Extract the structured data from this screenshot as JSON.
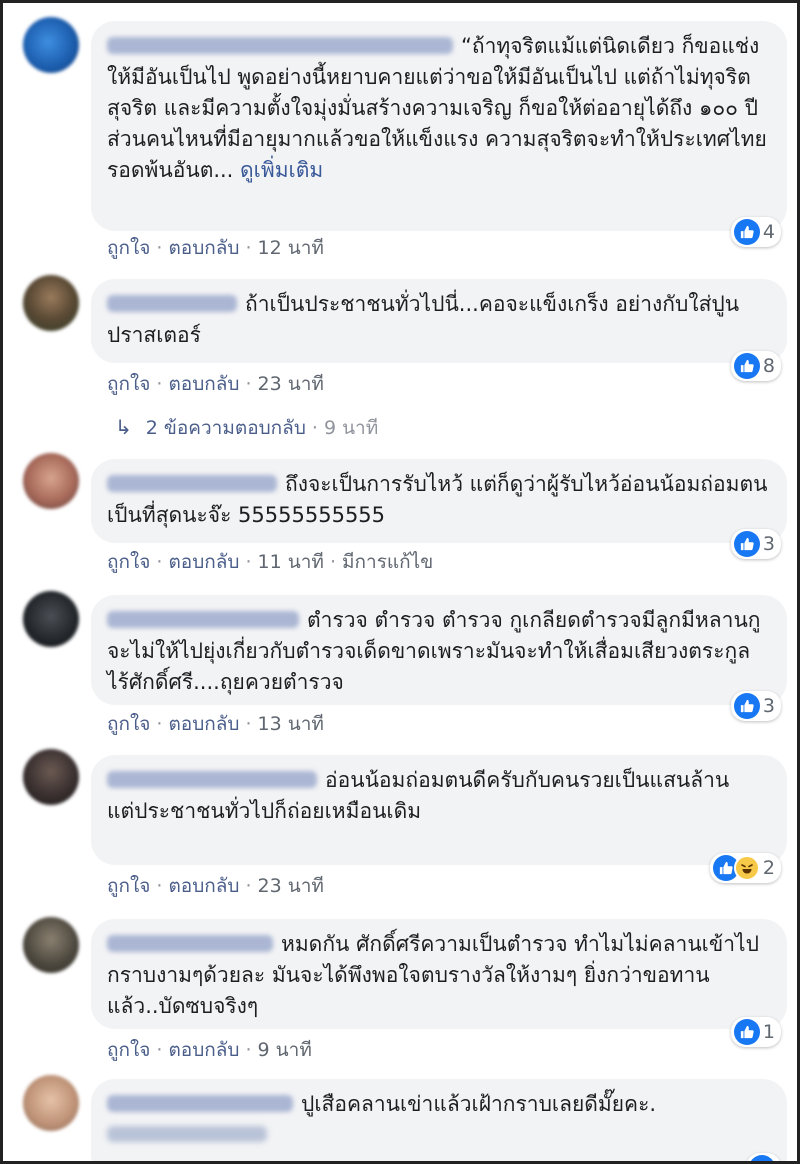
{
  "comments": [
    {
      "text": "“ถ้าทุจริตแม้แต่นิดเดียว ก็ขอแช่งให้มีอันเป็นไป พูดอย่างนี้หยาบคายแต่ว่าขอให้มีอันเป็นไป แต่ถ้าไม่ทุจริต สุจริต และมีความตั้งใจมุ่งมั่นสร้างความเจริญ ก็ขอให้ต่ออายุได้ถึง ๑๐๐ ปี ส่วนคนไหนที่มีอายุมากแล้วขอให้แข็งแรง ความสุจริตจะทำให้ประเทศไทยรอดพ้นอันต...",
      "see_more": "ดูเพิ่มเติม",
      "like": "ถูกใจ",
      "reply": "ตอบกลับ",
      "time": "12 นาที",
      "edited": "",
      "reaction_count": "4",
      "reactions": [
        "like-icon"
      ]
    },
    {
      "text": "ถ้าเป็นประชาชนทั่วไปนี่...คอจะแข็งเกร็ง อย่างกับใส่ปูนปราสเตอร์",
      "see_more": "",
      "like": "ถูกใจ",
      "reply": "ตอบกลับ",
      "time": "23 นาที",
      "edited": "",
      "reaction_count": "8",
      "reactions": [
        "like-icon"
      ],
      "replies_label": "2 ข้อความตอบกลับ",
      "replies_time": "9 นาที"
    },
    {
      "text": "ถึงจะเป็นการรับไหว้ แต่ก็ดูว่าผู้รับไหว้อ่อนน้อมถ่อมตนเป็นที่สุดนะจ๊ะ 55555555555",
      "see_more": "",
      "like": "ถูกใจ",
      "reply": "ตอบกลับ",
      "time": "11 นาที",
      "edited": "มีการแก้ไข",
      "reaction_count": "3",
      "reactions": [
        "like-icon"
      ]
    },
    {
      "text": "ตำรวจ ตำรวจ ตำรวจ กูเกลียดตำรวจมีลูกมีหลานกูจะไม่ให้ไปยุ่งเกี่ยวกับตำรวจเด็ดขาดเพราะมันจะทำให้เสื่อมเสียวงตระกูลไร้ศักดิ์ศรี....ถุยควยตำรวจ",
      "see_more": "",
      "like": "ถูกใจ",
      "reply": "ตอบกลับ",
      "time": "13 นาที",
      "edited": "",
      "reaction_count": "3",
      "reactions": [
        "like-icon"
      ]
    },
    {
      "text": "อ่อนน้อมถ่อมตนดีครับกับคนรวยเป็นแสนล้าน\nแต่ประชาชนทั่วไปก็ถ่อยเหมือนเดิม",
      "see_more": "",
      "like": "ถูกใจ",
      "reply": "ตอบกลับ",
      "time": "23 นาที",
      "edited": "",
      "reaction_count": "2",
      "reactions": [
        "like-icon",
        "haha-icon"
      ]
    },
    {
      "text": "หมดกัน ศักดิ์ศรีความเป็นตำรวจ ทำไมไม่คลานเข้าไปกราบงามๆด้วยละ มันจะได้พึงพอใจตบรางวัลให้งามๆ ยิ่งกว่าขอทานแล้ว..บัดซบจริงๆ",
      "see_more": "",
      "like": "ถูกใจ",
      "reply": "ตอบกลับ",
      "time": "9 นาที",
      "edited": "",
      "reaction_count": "1",
      "reactions": [
        "like-icon"
      ]
    },
    {
      "text": "ปูเสือคลานเข่าแล้วเฝ้ากราบเลยดีมั๊ยคะ.",
      "see_more": "",
      "like": "",
      "reply": "",
      "time": "",
      "edited": "",
      "reaction_count": "",
      "reactions": [
        "like-icon"
      ]
    }
  ],
  "colors": {
    "bubble": "#f2f3f5",
    "link": "#4b5e8a",
    "like_blue": "#1877f2",
    "meta_gray": "#606770"
  }
}
